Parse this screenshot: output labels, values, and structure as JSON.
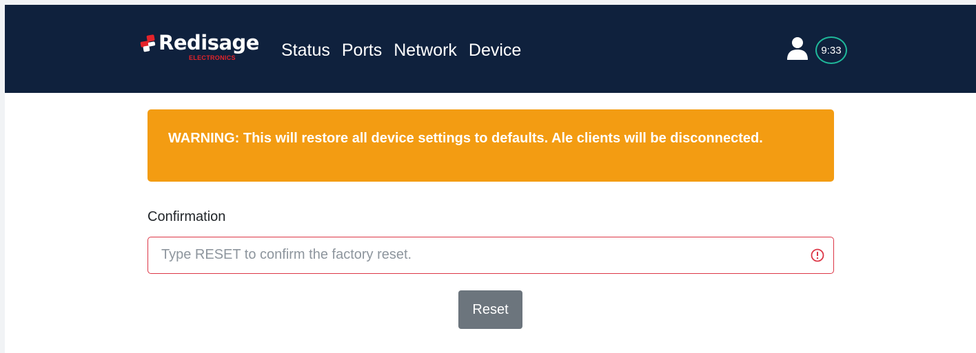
{
  "header": {
    "brand_name": "Redisage",
    "brand_sub": "ELECTRONICS",
    "nav": [
      {
        "label": "Status"
      },
      {
        "label": "Ports"
      },
      {
        "label": "Network"
      },
      {
        "label": "Device"
      }
    ],
    "user_icon": "user-icon",
    "session_timer": "9:33"
  },
  "warning": {
    "text": "WARNING: This will restore all device settings to defaults. Ale clients will be disconnected."
  },
  "form": {
    "label": "Confirmation",
    "placeholder": "Type RESET to confirm the factory reset.",
    "value": "",
    "validation_icon": "alert-circle-icon"
  },
  "actions": {
    "reset_label": "Reset"
  },
  "colors": {
    "navbar": "#0f213d",
    "brand_accent": "#e5232a",
    "warning": "#f39c12",
    "error": "#dc3545",
    "timer_ring": "#1fb89a",
    "button": "#6c757d"
  }
}
